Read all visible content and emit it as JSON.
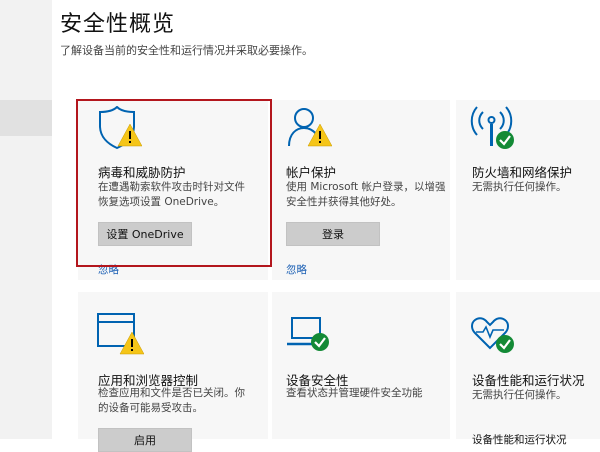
{
  "header": {
    "title": "安全性概览",
    "subtitle": "了解设备当前的安全性和运行情况并采取必要操作。"
  },
  "colors": {
    "accent": "#0063b1",
    "warning": "#f5c518",
    "ok": "#138a36",
    "highlight": "#b3161d"
  },
  "cards": [
    {
      "title": "病毒和威胁防护",
      "desc1": "在遭遇勒索软件攻击时针对文件",
      "desc2": "恢复选项设置 OneDrive。",
      "button": "设置 OneDrive",
      "link": "忽略",
      "icon": "shield-warning-icon"
    },
    {
      "title": "帐户保护",
      "desc1": "使用 Microsoft 帐户登录，以增强",
      "desc2": "安全性并获得其他好处。",
      "button": "登录",
      "link": "忽略",
      "icon": "account-warning-icon"
    },
    {
      "title": "防火墙和网络保护",
      "desc1": "无需执行任何操作。",
      "icon": "wifi-ok-icon"
    },
    {
      "title": "应用和浏览器控制",
      "desc1": "检查应用和文件是否已关闭。你",
      "desc2": "的设备可能易受攻击。",
      "button": "启用",
      "icon": "browser-warning-icon"
    },
    {
      "title": "设备安全性",
      "desc1": "查看状态并管理硬件安全功能",
      "icon": "laptop-ok-icon"
    },
    {
      "title": "设备性能和运行状况",
      "desc1": "无需执行任何操作。",
      "link": "设备性能和运行状况",
      "icon": "heart-ok-icon"
    }
  ]
}
